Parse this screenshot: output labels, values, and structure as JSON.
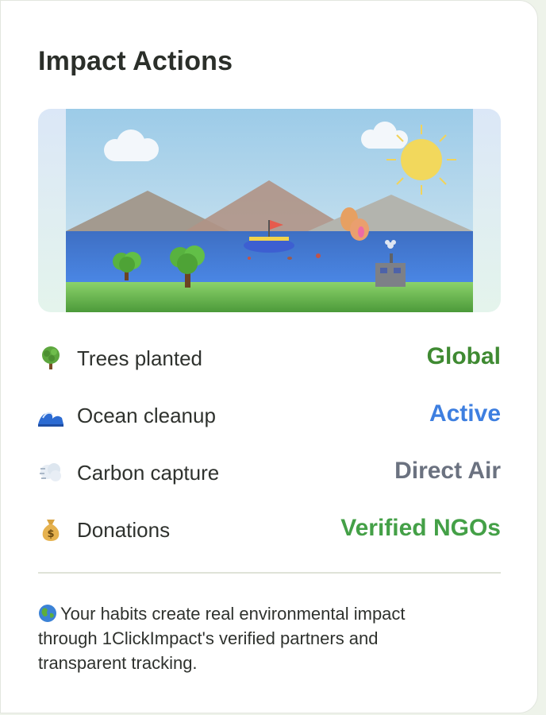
{
  "card": {
    "title": "Impact Actions"
  },
  "actions": [
    {
      "icon": "tree-icon",
      "label": "Trees planted",
      "value": "Global",
      "color": "#3f8a32"
    },
    {
      "icon": "wave-icon",
      "label": "Ocean cleanup",
      "value": "Active",
      "color": "#3e7fe0"
    },
    {
      "icon": "wind-icon",
      "label": "Carbon capture",
      "value": "Direct Air",
      "color": "#6b7280"
    },
    {
      "icon": "money-bag-icon",
      "label": "Donations",
      "value": "Verified NGOs",
      "color": "#44a047"
    }
  ],
  "footer": {
    "icon": "globe-icon",
    "text": "Your habits create real environmental impact through 1ClickImpact's verified partners and transparent tracking."
  }
}
